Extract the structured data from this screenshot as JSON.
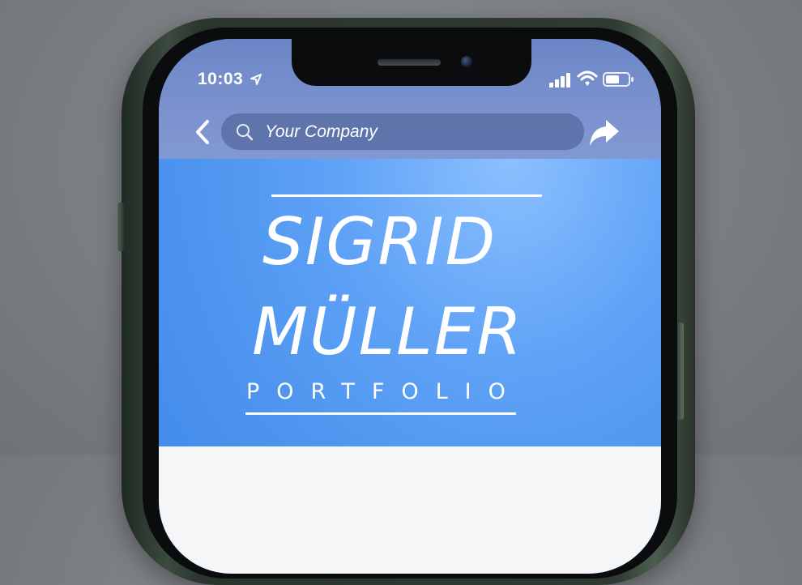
{
  "status_bar": {
    "time": "10:03"
  },
  "browser": {
    "url_placeholder": "Your Company"
  },
  "hero": {
    "first_name": "SIGRID",
    "last_name": "MÜLLER",
    "subtitle": "PORTFOLIO"
  },
  "icons": {
    "location": "location-arrow-icon",
    "signal": "cellular-signal-icon",
    "wifi": "wifi-icon",
    "battery": "battery-icon",
    "back": "chevron-left-icon",
    "search": "search-icon",
    "share": "share-arrow-icon"
  },
  "colors": {
    "hero_blue": "#4f95ef",
    "status_bar_blue": "#7c92cf",
    "phone_frame_green": "#3b4a3f",
    "background_gray": "#7b7e82"
  }
}
